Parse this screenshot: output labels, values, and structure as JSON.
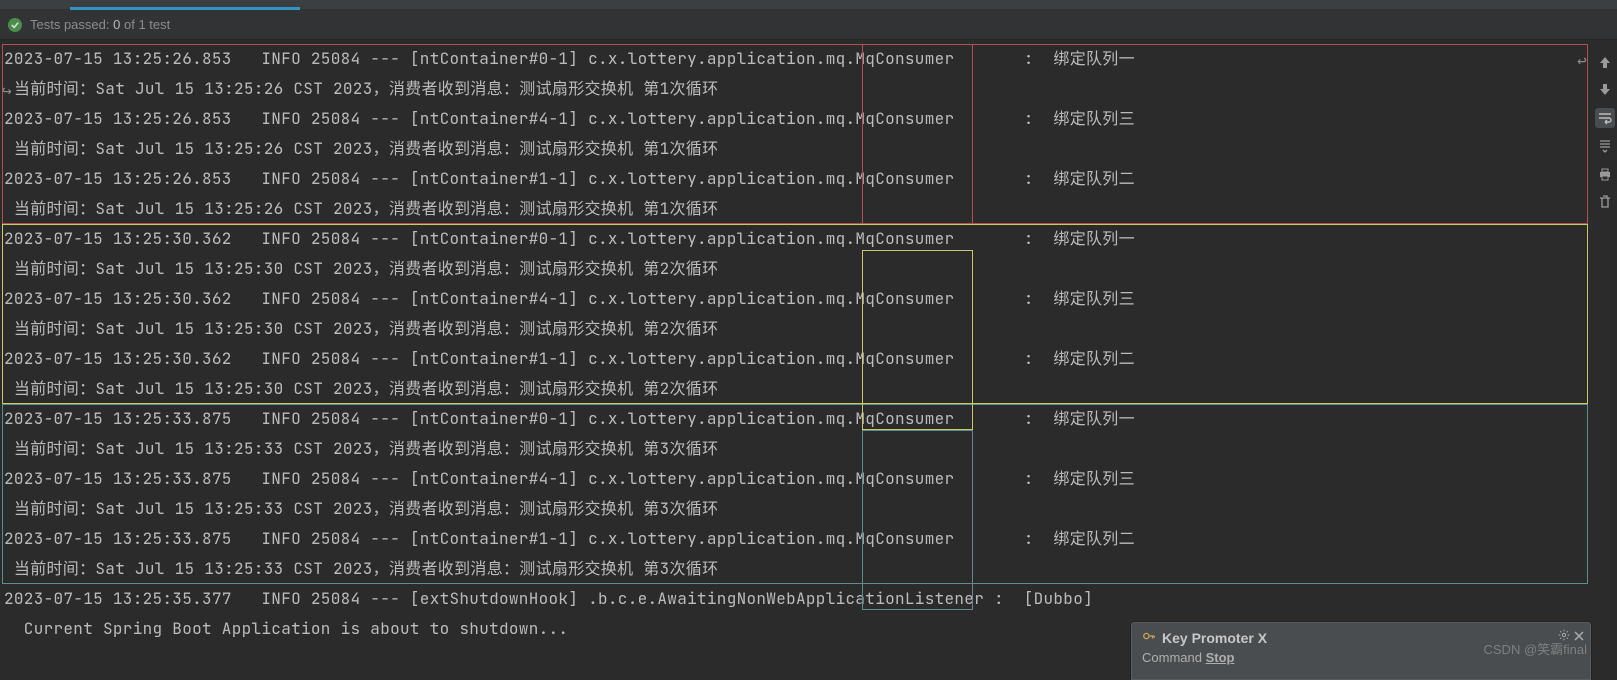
{
  "status": {
    "passed_label": "Tests passed:",
    "passed_count": "0",
    "of_label": "of",
    "total": "1 test"
  },
  "colors": {
    "box_red": "#b05050",
    "box_yellow": "#c8c864",
    "box_teal": "#5f8d8d"
  },
  "gutter_icons": [
    "arrow-up",
    "arrow-down",
    "soft-wrap",
    "scroll-end",
    "print",
    "trash"
  ],
  "notification": {
    "icon": "key-icon",
    "title": "Key Promoter X",
    "body_prefix": "Command ",
    "body_bold": "Stop"
  },
  "watermark": "CSDN @笑霸final",
  "log": [
    {
      "group": 0,
      "l1": "2023-07-15 13:25:26.853   INFO 25084 --- [ntContainer#0-1] c.x.lottery.application.mq.MqConsumer       :  绑定队列一",
      "l2": " 当前时间：Sat Jul 15 13:25:26 CST 2023，消费者收到消息：测试扇形交换机 第1次循环"
    },
    {
      "group": 0,
      "l1": "2023-07-15 13:25:26.853   INFO 25084 --- [ntContainer#4-1] c.x.lottery.application.mq.MqConsumer       :  绑定队列三",
      "l2": " 当前时间：Sat Jul 15 13:25:26 CST 2023，消费者收到消息：测试扇形交换机 第1次循环"
    },
    {
      "group": 0,
      "l1": "2023-07-15 13:25:26.853   INFO 25084 --- [ntContainer#1-1] c.x.lottery.application.mq.MqConsumer       :  绑定队列二",
      "l2": " 当前时间：Sat Jul 15 13:25:26 CST 2023，消费者收到消息：测试扇形交换机 第1次循环"
    },
    {
      "group": 1,
      "l1": "2023-07-15 13:25:30.362   INFO 25084 --- [ntContainer#0-1] c.x.lottery.application.mq.MqConsumer       :  绑定队列一",
      "l2": " 当前时间：Sat Jul 15 13:25:30 CST 2023，消费者收到消息：测试扇形交换机 第2次循环"
    },
    {
      "group": 1,
      "l1": "2023-07-15 13:25:30.362   INFO 25084 --- [ntContainer#4-1] c.x.lottery.application.mq.MqConsumer       :  绑定队列三",
      "l2": " 当前时间：Sat Jul 15 13:25:30 CST 2023，消费者收到消息：测试扇形交换机 第2次循环"
    },
    {
      "group": 1,
      "l1": "2023-07-15 13:25:30.362   INFO 25084 --- [ntContainer#1-1] c.x.lottery.application.mq.MqConsumer       :  绑定队列二",
      "l2": " 当前时间：Sat Jul 15 13:25:30 CST 2023，消费者收到消息：测试扇形交换机 第2次循环"
    },
    {
      "group": 2,
      "l1": "2023-07-15 13:25:33.875   INFO 25084 --- [ntContainer#0-1] c.x.lottery.application.mq.MqConsumer       :  绑定队列一",
      "l2": " 当前时间：Sat Jul 15 13:25:33 CST 2023，消费者收到消息：测试扇形交换机 第3次循环"
    },
    {
      "group": 2,
      "l1": "2023-07-15 13:25:33.875   INFO 25084 --- [ntContainer#4-1] c.x.lottery.application.mq.MqConsumer       :  绑定队列三",
      "l2": " 当前时间：Sat Jul 15 13:25:33 CST 2023，消费者收到消息：测试扇形交换机 第3次循环"
    },
    {
      "group": 2,
      "l1": "2023-07-15 13:25:33.875   INFO 25084 --- [ntContainer#1-1] c.x.lottery.application.mq.MqConsumer       :  绑定队列二",
      "l2": " 当前时间：Sat Jul 15 13:25:33 CST 2023，消费者收到消息：测试扇形交换机 第3次循环"
    }
  ],
  "tail": [
    "2023-07-15 13:25:35.377   INFO 25084 --- [extShutdownHook] .b.c.e.AwaitingNonWebApplicationListener :  [Dubbo]",
    "  Current Spring Boot Application is about to shutdown..."
  ]
}
